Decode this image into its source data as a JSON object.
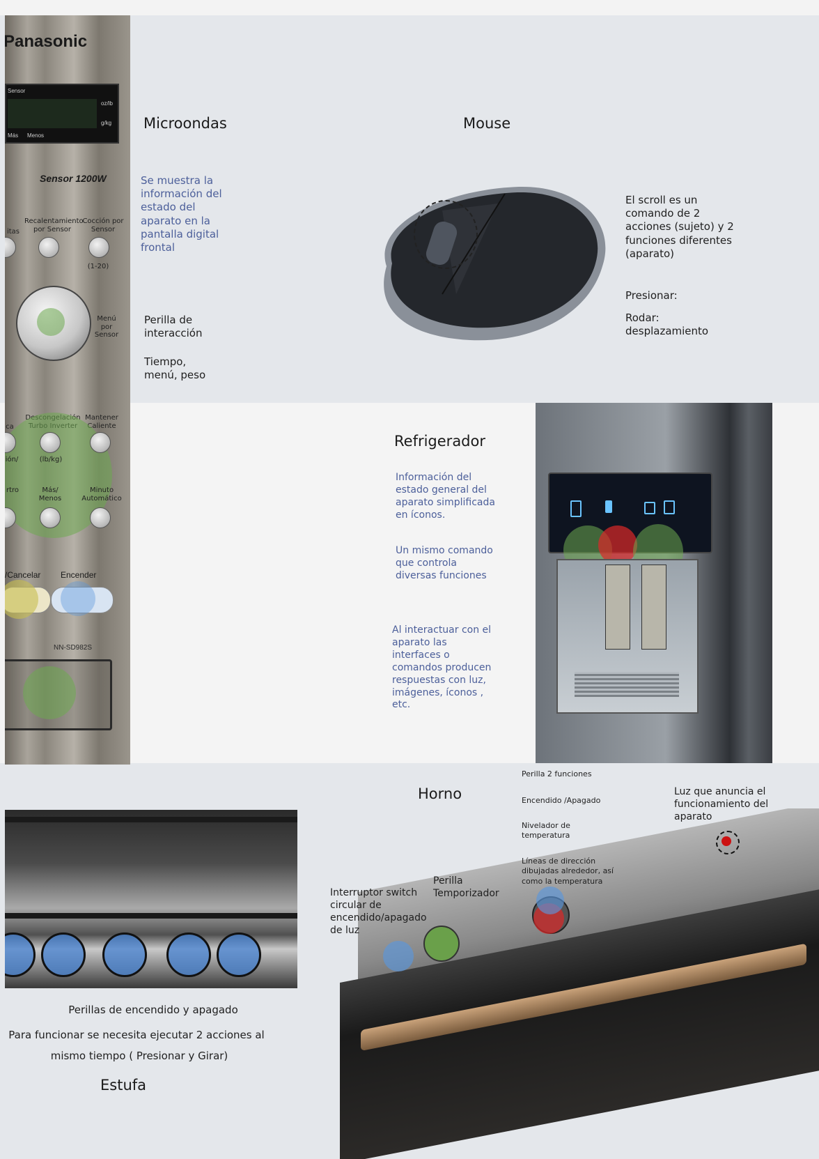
{
  "microwave": {
    "brand": "Panasonic",
    "display_label": "Sensor",
    "display_right_top": "oz/lb",
    "display_right_bottom": "g/kg",
    "display_more": "Más",
    "display_less": "Menos",
    "model_line": "Sensor 1200W",
    "btn_reheat": "Recalentamiento por Sensor",
    "btn_cook": "Cocción por Sensor",
    "btn_cook_range": "(1-20)",
    "btn_left_partial": "itas",
    "dial_label": "Menú por Sensor",
    "btn_defrost": "Descongelación Turbo Inverter",
    "btn_keep_warm": "Mantener Caliente",
    "btn_defrost_unit": "(lb/kg)",
    "btn_more_less": "Más/ Menos",
    "btn_minute": "Minuto Automático",
    "cancel": "/Cancelar",
    "start": "Encender",
    "model_number": "NN-SD982S",
    "left_partial_1": "ca",
    "left_partial_2": "rtro",
    "left_partial_3": "ión/"
  },
  "microondas": {
    "title": "Microondas",
    "info": "Se muestra la información del estado del aparato en la pantalla digital frontal",
    "knob_title": "Perilla de interacción",
    "knob_desc": "Tiempo, menú, peso"
  },
  "mouse": {
    "title": "Mouse",
    "desc": "El scroll es un comando de 2 acciones (sujeto) y 2 funciones diferentes (aparato)",
    "press": "Presionar:",
    "roll": "Rodar: desplazamiento"
  },
  "refrigerador": {
    "title": "Refrigerador",
    "info1": "Información del estado general del aparato simplificada en íconos.",
    "info2": "Un mismo comando que controla diversas funciones",
    "info3": "Al interactuar con el aparato las interfaces o comandos producen respuestas con luz, imágenes, íconos , etc."
  },
  "horno": {
    "title": "Horno",
    "knob2_title": "Perilla 2 funciones",
    "knob2_onoff": "Encendido /Apagado",
    "knob2_temp": "Nivelador de temperatura",
    "knob2_lines": "Líneas de dirección dibujadas alrededor, así como la temperatura",
    "light": "Luz que anuncia el funcionamiento del aparato",
    "switch": "Interruptor switch circular de encendido/apagado de luz",
    "timer": "Perilla Temporizador"
  },
  "estufa": {
    "title": "Estufa",
    "knobs": "Perillas de encendido y apagado",
    "desc_line1": "Para funcionar se necesita ejecutar 2 acciones al",
    "desc_line2": "mismo tiempo ( Presionar y Girar)"
  },
  "colors": {
    "page_bg": "#f3f3f3",
    "panel_bg": "#e4e7eb",
    "info_blue": "#4c5f9a",
    "highlight_green": "#6eaa50",
    "highlight_red": "#dc2828",
    "highlight_blue": "#5a96dc"
  }
}
